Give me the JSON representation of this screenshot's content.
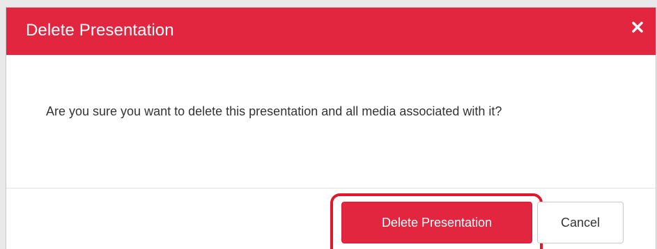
{
  "dialog": {
    "title": "Delete Presentation",
    "close_icon": "close-icon",
    "message": "Are you sure you want to delete this presentation and all media associated with it?",
    "confirm_label": "Delete Presentation",
    "cancel_label": "Cancel"
  },
  "colors": {
    "header": "#e3263f",
    "confirm_button": "#e3263f",
    "highlight_ring": "#e2172b",
    "text": "#333333"
  }
}
